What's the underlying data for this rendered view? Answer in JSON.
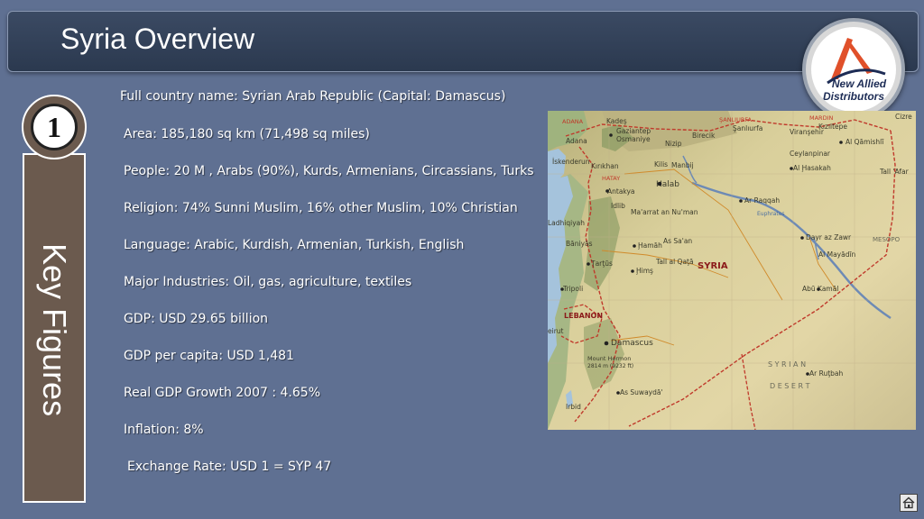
{
  "header": {
    "title": "Syria Overview"
  },
  "logo": {
    "line1": "New Allied",
    "line2": "Distributors"
  },
  "sidebar": {
    "number": "1",
    "label": "Key Figures"
  },
  "facts": [
    "Full country name: Syrian Arab Republic (Capital: Damascus)",
    "Area: 185,180 sq km (71,498 sq miles)",
    "People: 20 M , Arabs (90%), Kurds, Armenians, Circassians, Turks",
    "Religion: 74% Sunni Muslim, 16% other Muslim, 10% Christian",
    "Language: Arabic, Kurdish, Armenian, Turkish, English",
    "Major Industries: Oil, gas, agriculture, textiles",
    "GDP: USD 29.65 billion",
    "GDP per capita: USD 1,481",
    "Real GDP Growth 2007 : 4.65%",
    "Inflation: 8%",
    "Exchange Rate: USD 1 = SYP 47"
  ],
  "map": {
    "labels": {
      "syria": "SYRIA",
      "lebanon": "LEBANON",
      "adana": "Adana",
      "iskenderun": "İskenderun",
      "gaziantep": "Gaziantep",
      "osmaniye": "Osmaniye",
      "kilis": "Kilis",
      "nizip": "Nizip",
      "birecik": "Birecik",
      "sanliurfa": "Şanlıurfa",
      "viransehir": "Viranşehir",
      "kiziltepe": "Kızıltepe",
      "qamishli": "Al Qāmishlī",
      "ceylanpinar": "Ceylanpinar",
      "hasakah": "Al Ḩasakah",
      "tallafar": "Tall 'Afar",
      "manbij": "Manbij",
      "kirikhan": "Kırıkhan",
      "halab": "Halab",
      "antakya": "Antakya",
      "idlib": "Idlib",
      "maarrat": "Ma'arrat an Nu'man",
      "raqqah": "Ar Raqqah",
      "ladhiqiyah": "Ladhiqiyah",
      "hamah": "Ḩamāh",
      "assaan": "As Sa'an",
      "baniyas": "Bāniyās",
      "tartus": "Ţarţūs",
      "tallalqata": "Tall al Qaţā",
      "hims": "Ḩimş",
      "dayrazzawr": "Dayr az Zawr",
      "almayadin": "Al Mayādīn",
      "abukamal": "Abū Kamāl",
      "tripoli": "Tripoli",
      "beirut": "eirut",
      "damascus": "Damascus",
      "mounthermon": "Mount Hermon",
      "hermon_ft": "2814 m (9232 ft)",
      "assuwayda": "As Suwaydā'",
      "irbid": "Irbid",
      "arrutbah": "Ar Ruţbah",
      "syrian": "S Y R I A N",
      "desert": "D E S E R T",
      "mesopo": "MESOPO",
      "euphrates": "Euphrates",
      "sanliurfa_prov": "ŞANLIURFA",
      "mardin": "MARDIN",
      "adana_prov": "ADANA",
      "hatay": "HATAY",
      "kahta": "Kadeş",
      "zakho": "Cizre"
    }
  }
}
